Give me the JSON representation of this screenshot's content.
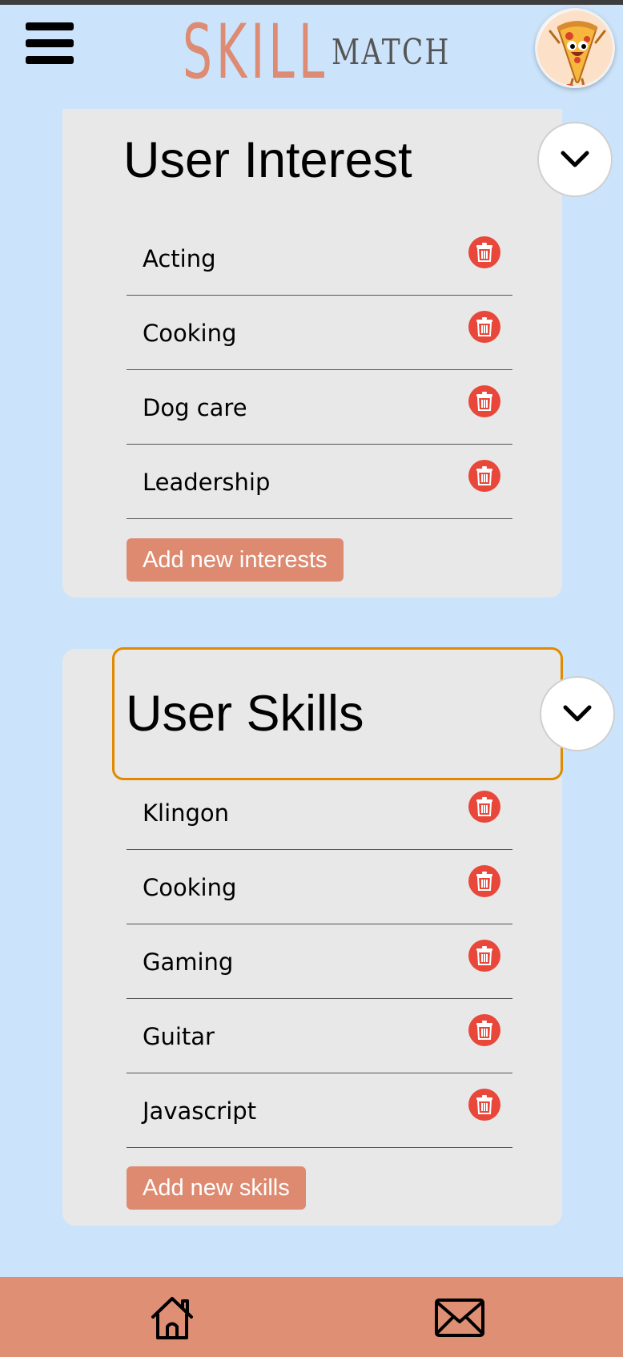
{
  "header": {
    "logo_primary": "SKILL",
    "logo_secondary": "MATCH",
    "menu_icon": "hamburger-menu-icon",
    "avatar_icon": "pizza-mascot-avatar"
  },
  "interests": {
    "title": "User Interest",
    "toggle_icon": "chevron-down-icon",
    "items": [
      {
        "label": "Acting"
      },
      {
        "label": "Cooking"
      },
      {
        "label": "Dog care"
      },
      {
        "label": "Leadership"
      }
    ],
    "add_label": "Add new interests"
  },
  "skills": {
    "title": "User Skills",
    "toggle_icon": "chevron-down-icon",
    "items": [
      {
        "label": "Klingon"
      },
      {
        "label": "Cooking"
      },
      {
        "label": "Gaming"
      },
      {
        "label": "Guitar"
      },
      {
        "label": "Javascript"
      }
    ],
    "add_label": "Add new skills"
  },
  "bottom_nav": {
    "items": [
      {
        "icon": "home-icon"
      },
      {
        "icon": "mail-icon"
      }
    ]
  },
  "colors": {
    "background": "#cce4fb",
    "card": "#e8e8e8",
    "accent": "#de8a70",
    "delete": "#e8473a",
    "focus_outline": "#e08a00"
  }
}
